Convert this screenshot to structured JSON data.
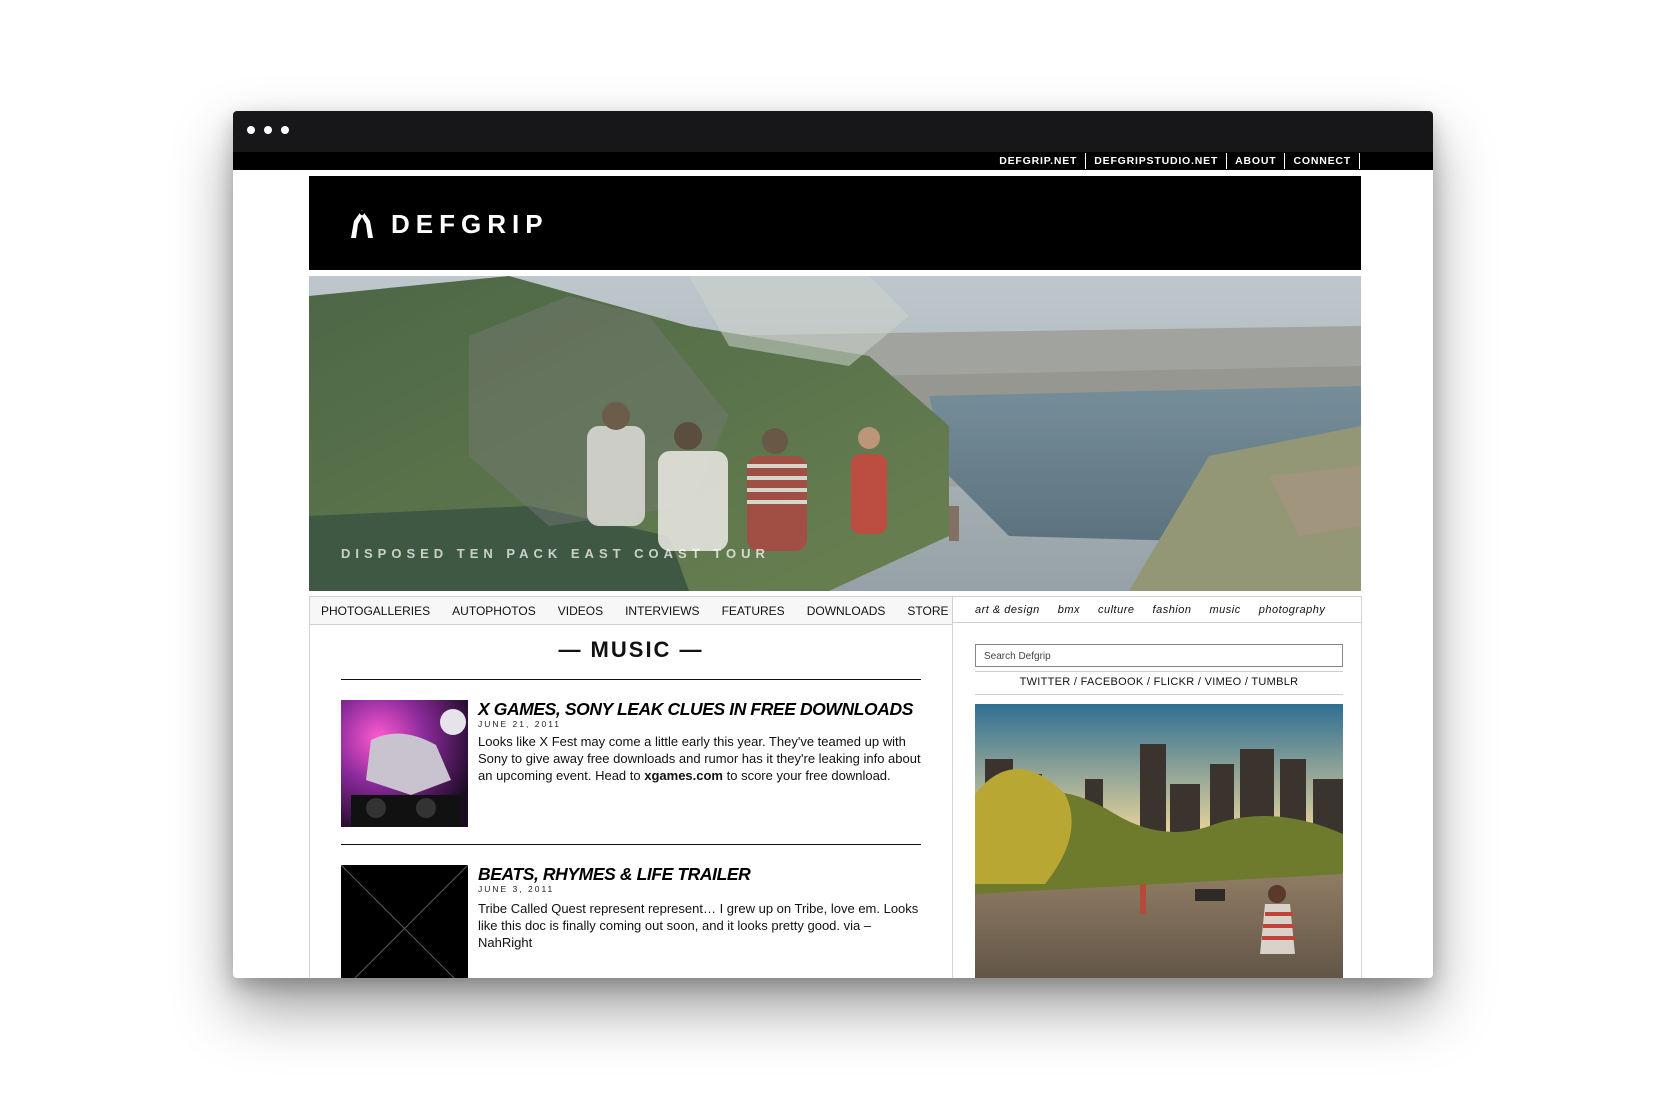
{
  "top_links": [
    "DEFGRIP.NET",
    "DEFGRIPSTUDIO.NET",
    "ABOUT",
    "CONNECT"
  ],
  "brand": {
    "name": "DEFGRIP"
  },
  "hero": {
    "caption": "DISPOSED TEN PACK EAST COAST TOUR"
  },
  "main_nav": [
    "PHOTOGALLERIES",
    "AUTOPHOTOS",
    "VIDEOS",
    "INTERVIEWS",
    "FEATURES",
    "DOWNLOADS",
    "STORE"
  ],
  "category_nav": [
    "art & design",
    "bmx",
    "culture",
    "fashion",
    "music",
    "photography"
  ],
  "section": {
    "title": "— MUSIC —"
  },
  "posts": [
    {
      "title": "X GAMES, SONY LEAK CLUES IN FREE DOWNLOADS",
      "date": "JUNE 21, 2011",
      "body_before": "Looks like X Fest may come a little early this year. They've teamed up with Sony to give away free downloads and rumor has it they're leaking info about an upcoming event. Head to ",
      "body_link": "xgames.com",
      "body_after": " to score your free download."
    },
    {
      "title": "BEATS, RHYMES & LIFE TRAILER",
      "date": "JUNE 3, 2011",
      "body": "Tribe Called Quest represent represent… I grew up on Tribe, love em. Looks like this doc is finally coming out soon, and it looks pretty good. via – NahRight"
    }
  ],
  "sidebar": {
    "search_placeholder": "Search Defgrip",
    "social_links": "TWITTER / FACEBOOK / FLICKR / VIMEO / TUMBLR"
  }
}
